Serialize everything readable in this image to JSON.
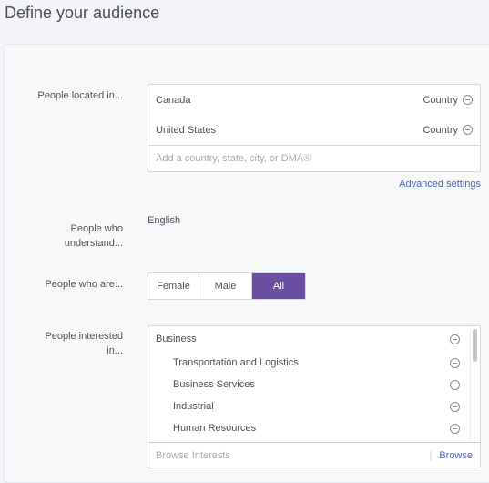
{
  "title": "Define your audience",
  "location": {
    "label": "People located in...",
    "items": [
      {
        "name": "Canada",
        "type": "Country"
      },
      {
        "name": "United States",
        "type": "Country"
      }
    ],
    "placeholder": "Add a country, state, city, or DMA®",
    "advanced": "Advanced settings"
  },
  "language": {
    "label": "People who understand...",
    "value": "English"
  },
  "gender": {
    "label": "People who are...",
    "options": [
      "Female",
      "Male",
      "All"
    ],
    "selected": "All",
    "accent": "#6a4fa0"
  },
  "interests": {
    "label": "People interested in...",
    "items": [
      {
        "name": "Business",
        "level": 0
      },
      {
        "name": "Transportation and Logistics",
        "level": 1
      },
      {
        "name": "Business Services",
        "level": 1
      },
      {
        "name": "Industrial",
        "level": 1
      },
      {
        "name": "Human Resources",
        "level": 1
      }
    ],
    "placeholder": "Browse Interests",
    "browse": "Browse"
  }
}
